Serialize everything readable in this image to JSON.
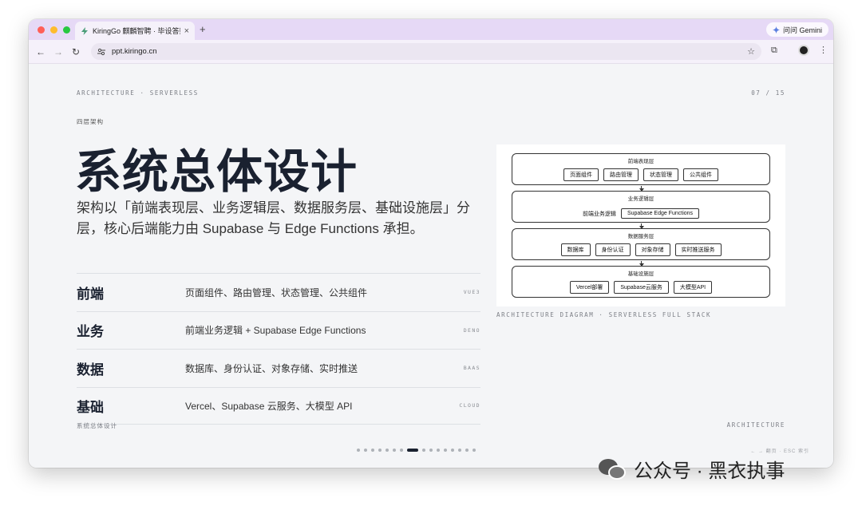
{
  "browser": {
    "tab_title": "KiringGo 麒麟智聘 · 毕设答辩",
    "tab_close": "×",
    "new_tab": "+",
    "gemini_label": "问问 Gemini",
    "url": "ppt.kiringo.cn",
    "traffic_lights": [
      "#ff5f57",
      "#febc2e",
      "#28c840"
    ]
  },
  "slide": {
    "top_left": "ARCHITECTURE · SERVERLESS",
    "page_counter": "07 / 15",
    "eyebrow": "四层架构",
    "headline": "系统总体设计",
    "subtitle": "架构以「前端表现层、业务逻辑层、数据服务层、基础设施层」分层，核心后端能力由 Supabase 与 Edge Functions 承担。",
    "layers": [
      {
        "name": "前端",
        "desc": "页面组件、路由管理、状态管理、公共组件",
        "tag": "VUE3"
      },
      {
        "name": "业务",
        "desc": "前端业务逻辑 + Supabase Edge Functions",
        "tag": "DENO"
      },
      {
        "name": "数据",
        "desc": "数据库、身份认证、对象存储、实时推送",
        "tag": "BAAS"
      },
      {
        "name": "基础",
        "desc": "Vercel、Supabase 云服务、大模型 API",
        "tag": "CLOUD"
      }
    ],
    "diagram": {
      "layers": [
        {
          "title": "前端表现层",
          "boxes": [
            "页面组件",
            "路由管理",
            "状态管理",
            "公共组件"
          ]
        },
        {
          "title": "业务逻辑层",
          "label": "前端业务逻辑",
          "boxes": [
            "Supabase Edge Functions"
          ]
        },
        {
          "title": "数据服务层",
          "boxes": [
            "数据库",
            "身份认证",
            "对象存储",
            "实时推送服务"
          ]
        },
        {
          "title": "基础设施层",
          "boxes": [
            "Vercel部署",
            "Supabase云服务",
            "大模型API"
          ]
        }
      ],
      "caption": "ARCHITECTURE DIAGRAM · SERVERLESS FULL STACK"
    },
    "footer_left": "系统总体设计",
    "footer_right": "ARCHITECTURE",
    "dots_total": 16,
    "dots_active": 7,
    "key_hint": "← → 翻页 · ESC 索引"
  },
  "watermark": "公众号 · 黑衣执事"
}
